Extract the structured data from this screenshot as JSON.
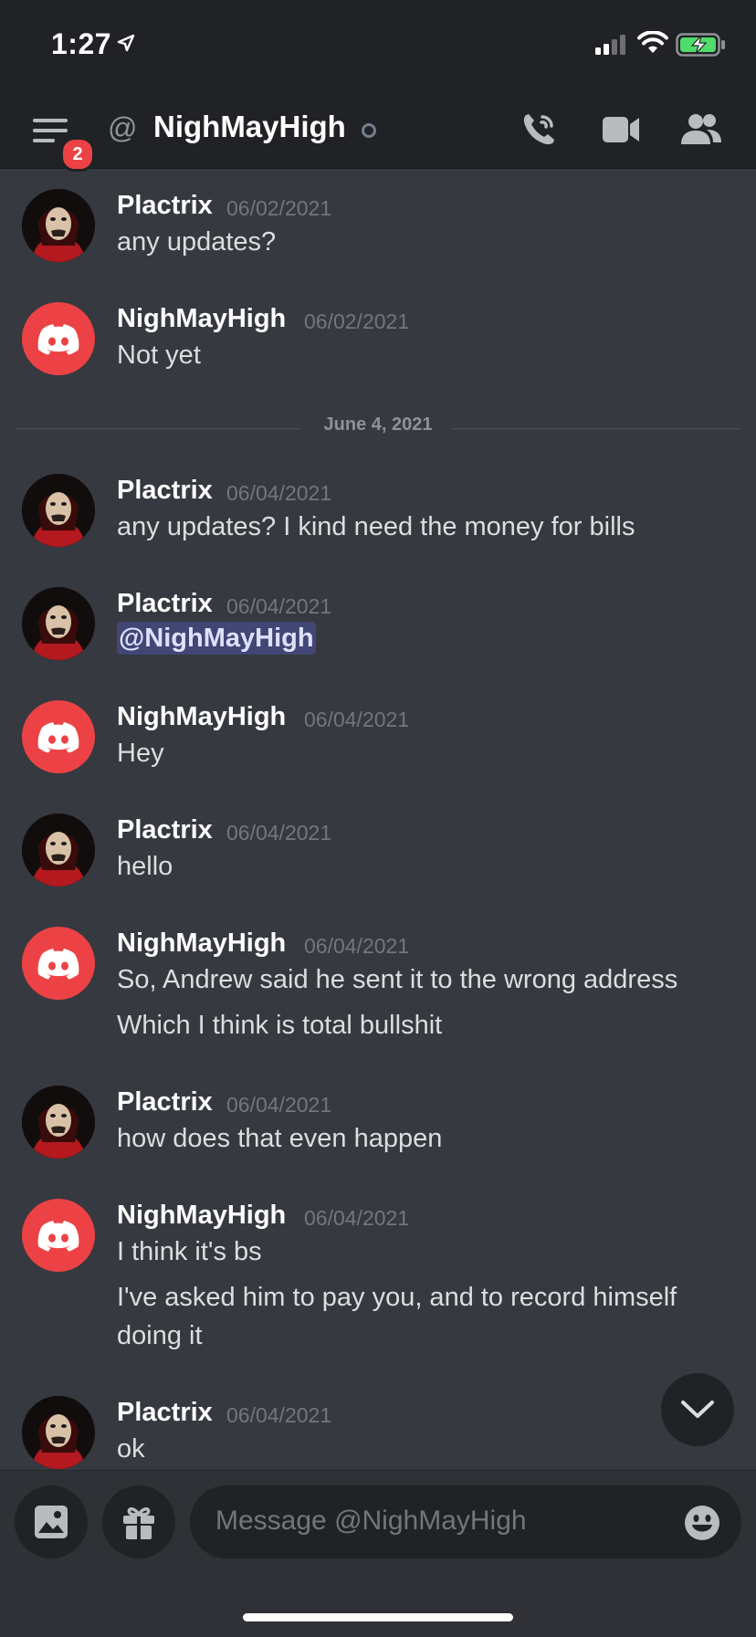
{
  "status_bar": {
    "time": "1:27"
  },
  "header": {
    "badge_count": "2",
    "at_symbol": "@",
    "channel_name": "NighMayHigh"
  },
  "messages": [
    {
      "author": "Plactrix",
      "timestamp": "06/02/2021",
      "lines": [
        "any updates?"
      ],
      "avatar": "plactrix-avatar"
    },
    {
      "author": "NighMayHigh",
      "timestamp": "06/02/2021",
      "lines": [
        "Not yet"
      ],
      "avatar": "discord-default-avatar"
    },
    {
      "author": "Plactrix",
      "timestamp": "06/04/2021",
      "lines": [
        "any updates? I kind need the money for bills"
      ],
      "avatar": "plactrix-avatar"
    },
    {
      "author": "Plactrix",
      "timestamp": "06/04/2021",
      "lines": [
        "@NighMayHigh"
      ],
      "avatar": "plactrix-avatar"
    },
    {
      "author": "NighMayHigh",
      "timestamp": "06/04/2021",
      "lines": [
        "Hey"
      ],
      "avatar": "discord-default-avatar"
    },
    {
      "author": "Plactrix",
      "timestamp": "06/04/2021",
      "lines": [
        "hello"
      ],
      "avatar": "plactrix-avatar"
    },
    {
      "author": "NighMayHigh",
      "timestamp": "06/04/2021",
      "lines": [
        "So, Andrew said he sent it to the wrong address",
        "Which I think is total bullshit"
      ],
      "avatar": "discord-default-avatar"
    },
    {
      "author": "Plactrix",
      "timestamp": "06/04/2021",
      "lines": [
        "how does that even happen"
      ],
      "avatar": "plactrix-avatar"
    },
    {
      "author": "NighMayHigh",
      "timestamp": "06/04/2021",
      "lines": [
        "I think it's bs",
        "I've asked him to pay you, and to record himself",
        "doing it"
      ],
      "avatar": "discord-default-avatar"
    },
    {
      "author": "Plactrix",
      "timestamp": "06/04/2021",
      "lines": [
        "ok"
      ],
      "avatar": "plactrix-avatar"
    }
  ],
  "date_divider": "June 4, 2021",
  "composer": {
    "placeholder": "Message @NighMayHigh"
  },
  "colors": {
    "background": "#36393f",
    "header": "#202225",
    "accent_red": "#ed4245",
    "mention_bg": "#414675"
  }
}
